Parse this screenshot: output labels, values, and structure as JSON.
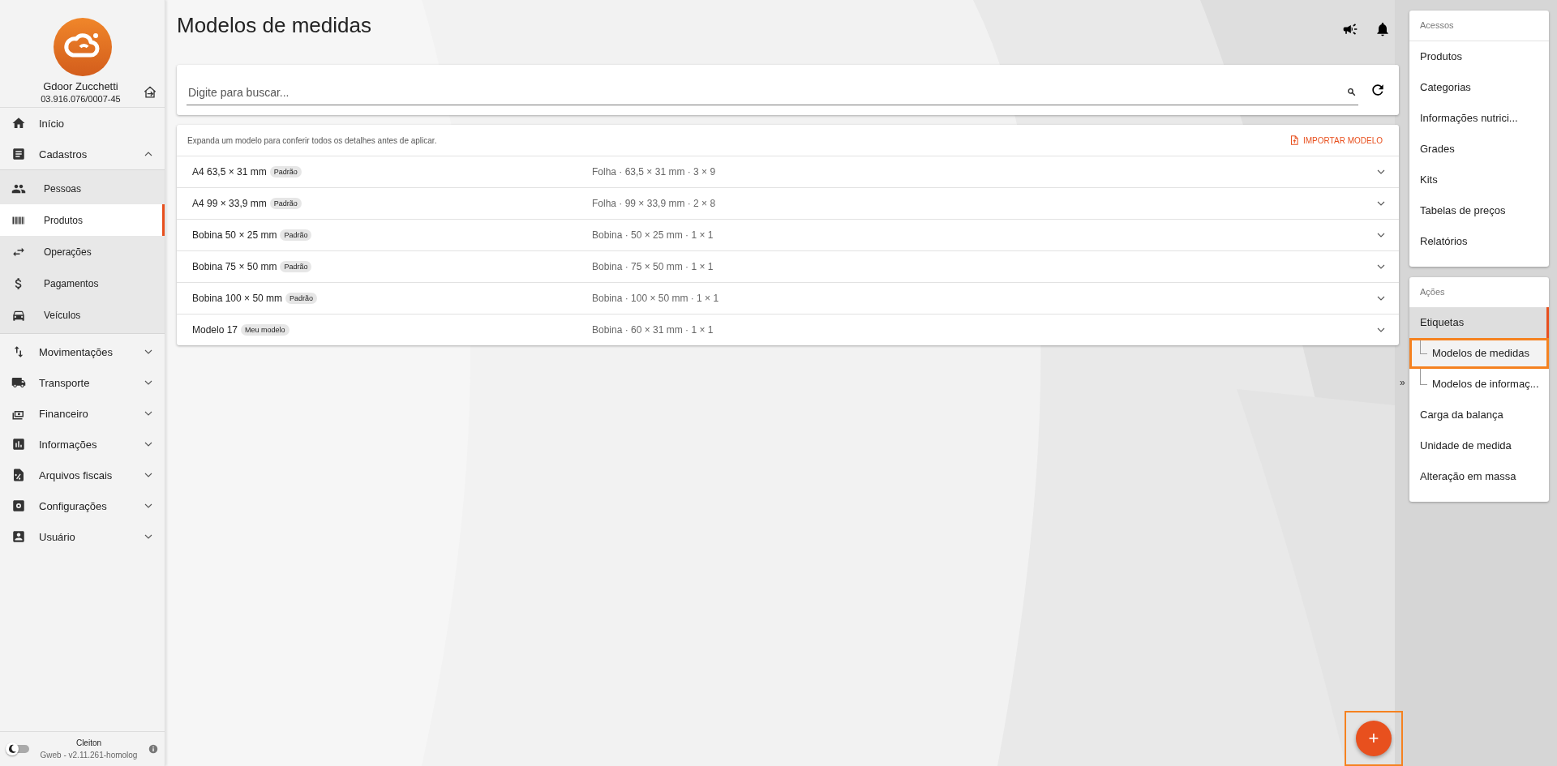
{
  "sidebar": {
    "company": {
      "name": "Gdoor Zucchetti",
      "document": "03.916.076/0007-45"
    },
    "menu": [
      {
        "kind": "link",
        "label": "Início",
        "selected": false
      },
      {
        "kind": "group",
        "label": "Cadastros",
        "expanded": true,
        "children": [
          {
            "label": "Pessoas",
            "selected": false
          },
          {
            "label": "Produtos",
            "selected": true
          },
          {
            "label": "Operações",
            "selected": false
          },
          {
            "label": "Pagamentos",
            "selected": false
          },
          {
            "label": "Veículos",
            "selected": false
          }
        ]
      },
      {
        "kind": "group",
        "label": "Movimentações",
        "expanded": false
      },
      {
        "kind": "group",
        "label": "Transporte",
        "expanded": false
      },
      {
        "kind": "group",
        "label": "Financeiro",
        "expanded": false
      },
      {
        "kind": "group",
        "label": "Informações",
        "expanded": false
      },
      {
        "kind": "group",
        "label": "Arquivos fiscais",
        "expanded": false
      },
      {
        "kind": "group",
        "label": "Configurações",
        "expanded": false
      },
      {
        "kind": "group",
        "label": "Usuário",
        "expanded": false
      }
    ],
    "footer": {
      "dark_mode": false,
      "user": "Cleiton",
      "version": "Gweb - v2.11.261-homolog"
    }
  },
  "page": {
    "title": "Modelos de medidas",
    "search": {
      "placeholder": "Digite para buscar..."
    },
    "models": {
      "hint": "Expanda um modelo para conferir todos os detalhes antes de aplicar.",
      "import_label": "IMPORTAR MODELO",
      "rows": [
        {
          "name": "A4 63,5 × 31 mm",
          "tag": "Padrão",
          "summary": "Folha · 63,5 × 31 mm · 3 × 9",
          "expanded": false
        },
        {
          "name": "A4 99 × 33,9 mm",
          "tag": "Padrão",
          "summary": "Folha · 99 × 33,9 mm · 2 × 8",
          "expanded": false
        },
        {
          "name": "Bobina 50 × 25 mm",
          "tag": "Padrão",
          "summary": "Bobina · 50 × 25 mm · 1 × 1",
          "expanded": false
        },
        {
          "name": "Bobina 75 × 50 mm",
          "tag": "Padrão",
          "summary": "Bobina · 75 × 50 mm · 1 × 1",
          "expanded": false
        },
        {
          "name": "Bobina 100 × 50 mm",
          "tag": "Padrão",
          "summary": "Bobina · 100 × 50 mm · 1 × 1",
          "expanded": false
        },
        {
          "name": "Modelo 17",
          "tag": "Meu modelo",
          "summary": "Bobina · 60 × 31 mm · 1 × 1",
          "expanded": false
        }
      ]
    },
    "add_button": {
      "label": "+"
    }
  },
  "side_panel": {
    "collapse_toggle": "»",
    "sections": [
      {
        "title": "Acessos",
        "items": [
          {
            "label": "Produtos",
            "selected": false
          },
          {
            "label": "Categorias",
            "selected": false
          },
          {
            "label": "Informações nutrici...",
            "selected": false
          },
          {
            "label": "Grades",
            "selected": false
          },
          {
            "label": "Kits",
            "selected": false
          },
          {
            "label": "Tabelas de preços",
            "selected": false
          },
          {
            "label": "Relatórios",
            "selected": false
          }
        ]
      },
      {
        "title": "Ações",
        "items": [
          {
            "label": "Etiquetas",
            "selected": false,
            "active": true,
            "children": [
              {
                "label": "Modelos de medidas",
                "selected": true
              },
              {
                "label": "Modelos de informaç...",
                "selected": false
              }
            ]
          },
          {
            "label": "Carga da balança",
            "selected": false
          },
          {
            "label": "Unidade de medida",
            "selected": false
          },
          {
            "label": "Alteração em massa",
            "selected": false
          }
        ]
      }
    ]
  }
}
